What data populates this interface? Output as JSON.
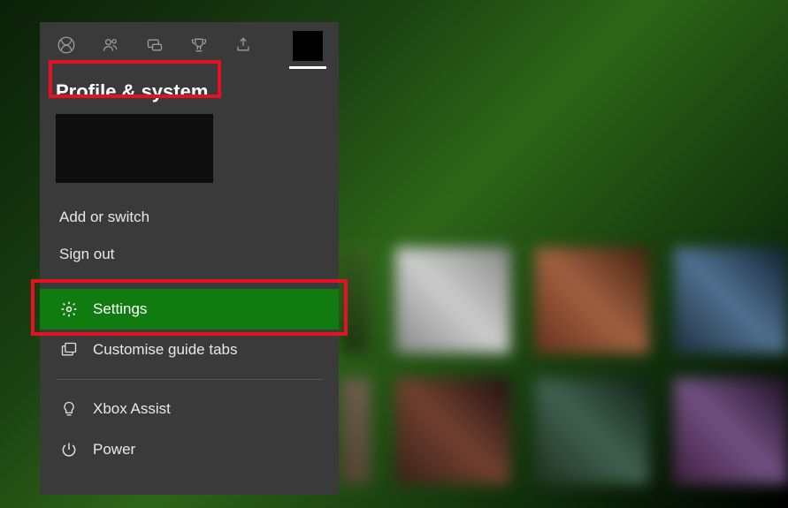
{
  "panel": {
    "title": "Profile & system"
  },
  "tabs": [
    {
      "name": "xbox-icon"
    },
    {
      "name": "people-icon"
    },
    {
      "name": "chat-icon"
    },
    {
      "name": "trophy-icon"
    },
    {
      "name": "share-icon"
    }
  ],
  "account": {
    "add_or_switch": "Add or switch",
    "sign_out": "Sign out"
  },
  "menu": {
    "settings": "Settings",
    "customise_guide_tabs": "Customise guide tabs",
    "xbox_assist": "Xbox Assist",
    "power": "Power"
  },
  "colors": {
    "accent": "#107c10",
    "highlight": "#e81123",
    "panel_bg": "#3a3a3a"
  },
  "background_tiles": [
    [
      "#2d4020",
      "#a0a0a0",
      "#804030",
      "#305060"
    ],
    [
      "#606050",
      "#4a2020",
      "#305040",
      "#503050"
    ]
  ]
}
